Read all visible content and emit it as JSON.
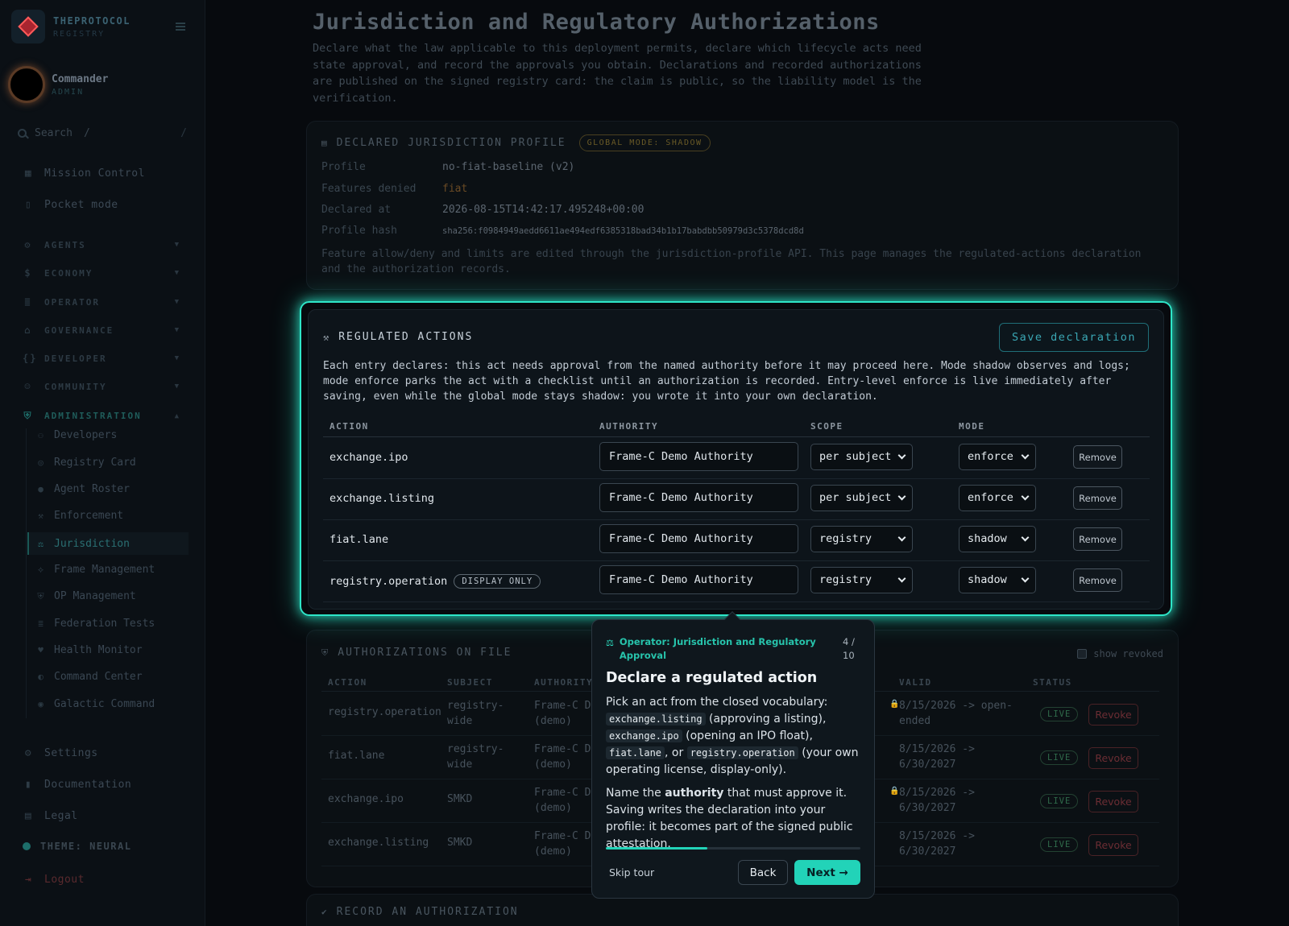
{
  "sidebar": {
    "brand": {
      "name": "THEPROTOCOL",
      "sub": "REGISTRY"
    },
    "user": {
      "name": "Commander",
      "role": "ADMIN"
    },
    "search": {
      "placeholder": "Search",
      "shortcut": "/"
    },
    "top_items": [
      {
        "label": "Mission Control",
        "icon": "grid-icon"
      },
      {
        "label": "Pocket mode",
        "icon": "phone-icon"
      }
    ],
    "sections": [
      {
        "label": "AGENTS",
        "icon": "robot-icon"
      },
      {
        "label": "ECONOMY",
        "icon": "dollar-icon"
      },
      {
        "label": "OPERATOR",
        "icon": "server-icon"
      },
      {
        "label": "GOVERNANCE",
        "icon": "bank-icon"
      },
      {
        "label": "DEVELOPER",
        "icon": "code-icon"
      },
      {
        "label": "COMMUNITY",
        "icon": "people-icon"
      },
      {
        "label": "ADMINISTRATION",
        "icon": "shield-icon"
      }
    ],
    "admin_items": [
      {
        "label": "Developers",
        "icon": "user-plus-icon"
      },
      {
        "label": "Registry Card",
        "icon": "badge-icon"
      },
      {
        "label": "Agent Roster",
        "icon": "person-icon"
      },
      {
        "label": "Enforcement",
        "icon": "gavel-icon"
      },
      {
        "label": "Jurisdiction",
        "icon": "scales-icon"
      },
      {
        "label": "Frame Management",
        "icon": "frame-icon"
      },
      {
        "label": "OP Management",
        "icon": "shield-icon"
      },
      {
        "label": "Federation Tests",
        "icon": "list-icon"
      },
      {
        "label": "Health Monitor",
        "icon": "heart-icon"
      },
      {
        "label": "Command Center",
        "icon": "dial-icon"
      },
      {
        "label": "Galactic Command",
        "icon": "target-icon"
      }
    ],
    "bottom_items": [
      {
        "label": "Settings",
        "icon": "gear-icon"
      },
      {
        "label": "Documentation",
        "icon": "book-icon"
      },
      {
        "label": "Legal",
        "icon": "document-icon"
      }
    ],
    "theme": "THEME: NEURAL",
    "logout": "Logout"
  },
  "page": {
    "title": "Jurisdiction and Regulatory Authorizations",
    "description": "Declare what the law applicable to this deployment permits, declare which lifecycle acts need state approval, and record the approvals you obtain. Declarations and recorded authorizations are published on the signed registry card: the claim is public, so the liability model is the verification."
  },
  "profile": {
    "heading": "DECLARED JURISDICTION PROFILE",
    "mode_pill": "GLOBAL MODE: SHADOW",
    "rows": [
      {
        "key": "Profile",
        "value": "no-fiat-baseline (v2)"
      },
      {
        "key": "Features denied",
        "value": "fiat"
      },
      {
        "key": "Declared at",
        "value": "2026-08-15T14:42:17.495248+00:00"
      },
      {
        "key": "Profile hash",
        "value": "sha256:f0984949aedd6611ae494edf6385318bad34b1b17babdbb50979d3c5378dcd8d"
      }
    ],
    "note": "Feature allow/deny and limits are edited through the jurisdiction-profile API. This page manages the regulated-actions declaration and the authorization records."
  },
  "regulated": {
    "heading": "REGULATED ACTIONS",
    "save_label": "Save declaration",
    "description": "Each entry declares: this act needs approval from the named authority before it may proceed here. Mode shadow observes and logs; mode enforce parks the act with a checklist until an authorization is recorded. Entry-level enforce is live immediately after saving, even while the global mode stays shadow: you wrote it into your own declaration.",
    "columns": [
      "ACTION",
      "AUTHORITY",
      "SCOPE",
      "MODE"
    ],
    "rows": [
      {
        "action": "exchange.ipo",
        "pill": "",
        "authority": "Frame-C Demo Authority",
        "scope": "per subject",
        "mode": "enforce",
        "remove": "Remove"
      },
      {
        "action": "exchange.listing",
        "pill": "",
        "authority": "Frame-C Demo Authority",
        "scope": "per subject",
        "mode": "enforce",
        "remove": "Remove"
      },
      {
        "action": "fiat.lane",
        "pill": "",
        "authority": "Frame-C Demo Authority",
        "scope": "registry",
        "mode": "shadow",
        "remove": "Remove"
      },
      {
        "action": "registry.operation",
        "pill": "DISPLAY ONLY",
        "authority": "Frame-C Demo Authority",
        "scope": "registry",
        "mode": "shadow",
        "remove": "Remove"
      }
    ]
  },
  "authorizations": {
    "heading": "AUTHORIZATIONS ON FILE",
    "show_revoked": "show revoked",
    "columns": [
      "ACTION",
      "SUBJECT",
      "AUTHORITY",
      "VALID",
      "STATUS"
    ],
    "rows": [
      {
        "action": "registry.operation",
        "subject": "registry-\nwide",
        "authority": "Frame-C De\n(demo)",
        "valid": "8/15/2026 -> open-\nended",
        "status": "LIVE",
        "revoke": "Revoke"
      },
      {
        "action": "fiat.lane",
        "subject": "registry-\nwide",
        "authority": "Frame-C De\n(demo)",
        "valid": "8/15/2026 ->\n6/30/2027",
        "status": "LIVE",
        "revoke": "Revoke"
      },
      {
        "action": "exchange.ipo",
        "subject": "SMKD",
        "authority": "Frame-C De\n(demo)",
        "valid": "8/15/2026 ->\n6/30/2027",
        "status": "LIVE",
        "revoke": "Revoke"
      },
      {
        "action": "exchange.listing",
        "subject": "SMKD",
        "authority": "Frame-C De\n(demo)",
        "valid": "8/15/2026 ->\n6/30/2027",
        "status": "LIVE",
        "revoke": "Revoke"
      }
    ]
  },
  "record": {
    "heading": "RECORD AN AUTHORIZATION"
  },
  "tour": {
    "context": "Operator: Jurisdiction and Regulatory Approval",
    "step": "4 / 10",
    "progress": 0.4,
    "title": "Declare a regulated action",
    "p1_a": "Pick an act from the closed vocabulary: ",
    "code1": "exchange.listing",
    "p1_b": " (approving a listing), ",
    "code2": "exchange.ipo",
    "p1_c": " (opening an IPO float), ",
    "code3": "fiat.lane",
    "p1_d": ", or ",
    "code4": "registry.operation",
    "p1_e": " (your own operating license, display-only).",
    "p2_a": "Name the ",
    "p2_bold": "authority",
    "p2_b": " that must approve it. Saving writes the declaration into your profile: it becomes part of the signed public attestation.",
    "skip": "Skip tour",
    "back": "Back",
    "next": "Next →"
  }
}
